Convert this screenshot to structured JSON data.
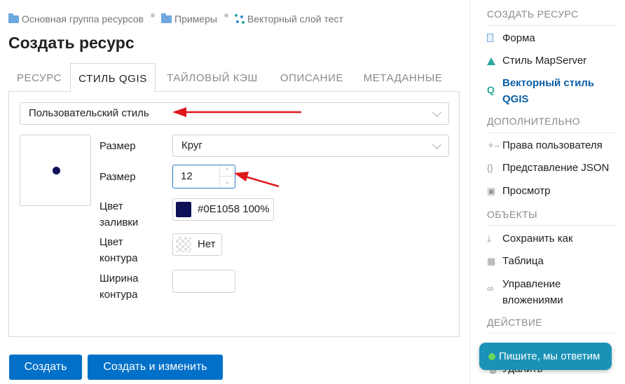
{
  "breadcrumb": {
    "items": [
      "Основная группа ресурсов",
      "Примеры",
      "Векторный слой тест"
    ]
  },
  "page": {
    "title": "Создать ресурс"
  },
  "tabs": [
    {
      "label": "РЕСУРС",
      "active": false
    },
    {
      "label": "СТИЛЬ QGIS",
      "active": true
    },
    {
      "label": "ТАЙЛОВЫЙ КЭШ",
      "active": false
    },
    {
      "label": "ОПИСАНИЕ",
      "active": false
    },
    {
      "label": "МЕТАДАННЫЕ",
      "active": false
    }
  ],
  "style_select": {
    "value": "Пользовательский стиль"
  },
  "form": {
    "shape_label": "Размер",
    "shape_value": "Круг",
    "size_label": "Размер",
    "size_value": "12",
    "fill_label_1": "Цвет",
    "fill_label_2": "заливки",
    "fill_value": "#0E1058 100%",
    "fill_color": "#0E1058",
    "stroke_label_1": "Цвет",
    "stroke_label_2": "контура",
    "stroke_value": "Нет",
    "stroke_width_label_1": "Ширина",
    "stroke_width_label_2": "контура",
    "stroke_width_value": ""
  },
  "buttons": {
    "create": "Создать",
    "create_edit": "Создать и изменить"
  },
  "sidebar": {
    "create_heading": "СОЗДАТЬ РЕСУРС",
    "create_items": [
      {
        "label": "Форма",
        "icon": "form-icon"
      },
      {
        "label": "Стиль MapServer",
        "icon": "mapserver-style-icon"
      },
      {
        "label": "Векторный стиль QGIS",
        "icon": "qgis-style-icon",
        "active": true
      }
    ],
    "extra_heading": "ДОПОЛНИТЕЛЬНО",
    "extra_items": [
      {
        "label": "Права пользователя",
        "icon": "key-icon"
      },
      {
        "label": "Представление JSON",
        "icon": "braces-icon"
      },
      {
        "label": "Просмотр",
        "icon": "preview-icon"
      }
    ],
    "objects_heading": "ОБЪЕКТЫ",
    "objects_items": [
      {
        "label": "Сохранить как",
        "icon": "download-icon"
      },
      {
        "label": "Таблица",
        "icon": "table-icon"
      },
      {
        "label": "Управление вложениями",
        "icon": "paperclip-icon"
      }
    ],
    "action_heading": "ДЕЙСТВИЕ",
    "action_items": [
      {
        "label": "Удалить",
        "icon": "delete-icon"
      }
    ]
  },
  "chat": {
    "label": "Пишите, мы ответим"
  },
  "colors": {
    "accent": "#0070c9",
    "active_link": "#0b5fa8",
    "chat_bg": "#1a92b8",
    "arrow": "#e0161d"
  }
}
